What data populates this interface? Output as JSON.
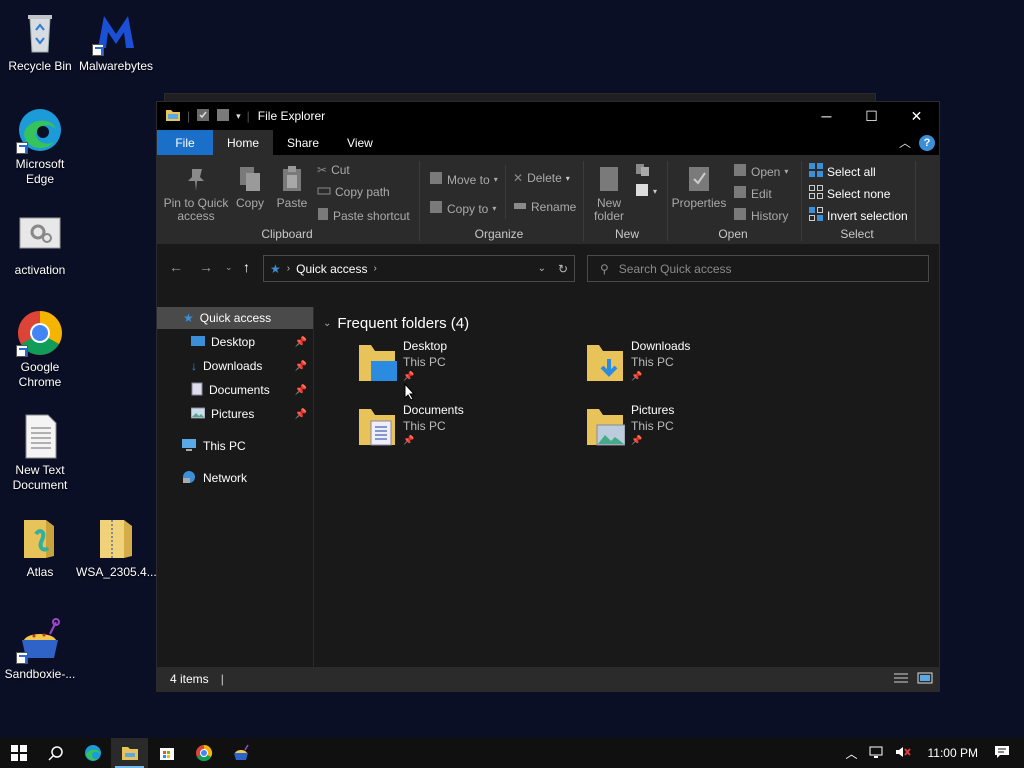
{
  "desktop": {
    "icons": [
      {
        "label": "Recycle Bin",
        "icon": "recycle-bin-icon"
      },
      {
        "label": "Malwarebytes",
        "icon": "malwarebytes-icon"
      },
      {
        "label": "Microsoft Edge",
        "icon": "edge-icon"
      },
      {
        "label": "activation",
        "icon": "settings-file-icon"
      },
      {
        "label": "Google Chrome",
        "icon": "chrome-icon"
      },
      {
        "label": "New Text Document",
        "icon": "text-document-icon"
      },
      {
        "label": "Atlas",
        "icon": "folder-icon"
      },
      {
        "label": "WSA_2305.4...",
        "icon": "zip-folder-icon"
      },
      {
        "label": "Sandboxie-...",
        "icon": "sandboxie-icon"
      }
    ]
  },
  "window": {
    "title": "File Explorer",
    "controls": {
      "minimize": "─",
      "maximize": "☐",
      "close": "✕"
    }
  },
  "ribbon": {
    "tabs": [
      "File",
      "Home",
      "Share",
      "View"
    ],
    "active_tab": "Home",
    "help": "?",
    "groups": {
      "clipboard": {
        "label": "Clipboard",
        "pin": "Pin to Quick access",
        "copy": "Copy",
        "paste": "Paste",
        "cut": "Cut",
        "copy_path": "Copy path",
        "paste_shortcut": "Paste shortcut"
      },
      "organize": {
        "label": "Organize",
        "move_to": "Move to",
        "copy_to": "Copy to",
        "delete": "Delete",
        "rename": "Rename"
      },
      "new": {
        "label": "New",
        "new_folder": "New folder"
      },
      "open": {
        "label": "Open",
        "properties": "Properties",
        "open": "Open",
        "edit": "Edit",
        "history": "History"
      },
      "select": {
        "label": "Select",
        "select_all": "Select all",
        "select_none": "Select none",
        "invert": "Invert selection"
      }
    }
  },
  "address": {
    "path": "Quick access",
    "search_placeholder": "Search Quick access"
  },
  "navpane": {
    "quick_access": "Quick access",
    "pinned": [
      "Desktop",
      "Downloads",
      "Documents",
      "Pictures"
    ],
    "this_pc": "This PC",
    "network": "Network"
  },
  "content": {
    "section_title": "Frequent folders (4)",
    "folders": [
      {
        "name": "Desktop",
        "location": "This PC"
      },
      {
        "name": "Downloads",
        "location": "This PC"
      },
      {
        "name": "Documents",
        "location": "This PC"
      },
      {
        "name": "Pictures",
        "location": "This PC"
      }
    ]
  },
  "status": {
    "items": "4 items"
  },
  "taskbar": {
    "clock": "11:00 PM"
  },
  "colors": {
    "accent": "#1a6fc8",
    "desktop_bg": "#0b0f26",
    "window_bg": "#191919"
  }
}
